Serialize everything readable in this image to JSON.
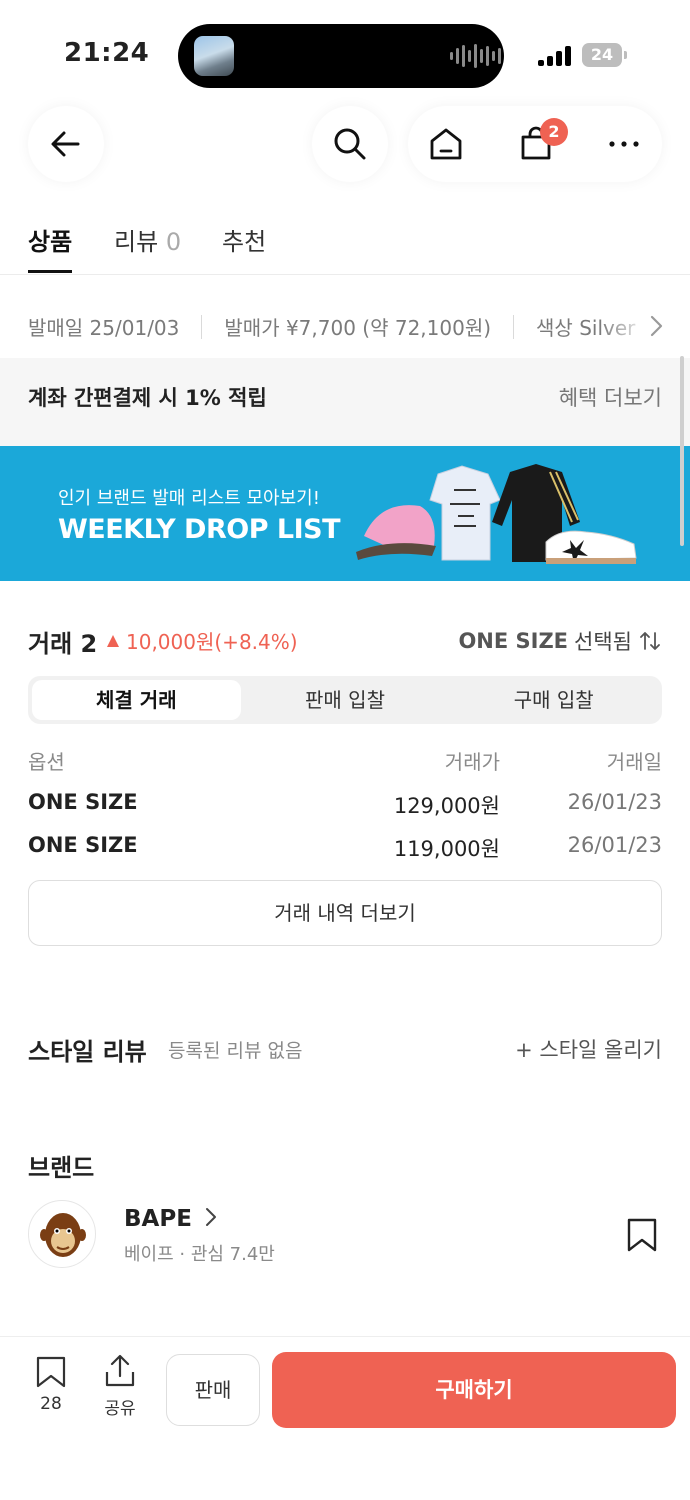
{
  "status_bar": {
    "time": "21:24",
    "battery": "24"
  },
  "header": {
    "cart_count": "2"
  },
  "tabs": [
    {
      "label": "상품"
    },
    {
      "label": "리뷰",
      "count": "0"
    },
    {
      "label": "추천"
    }
  ],
  "info_strip": {
    "release_date": "발매일 25/01/03",
    "release_price": "발매가 ¥7,700 (약 72,100원)",
    "color": "색상 Silver"
  },
  "benefit": {
    "text": "계좌 간편결제 시 1% 적립",
    "link": "혜택 더보기"
  },
  "banner": {
    "subtitle": "인기 브랜드 발매 리스트 모아보기!",
    "title": "WEEKLY DROP LIST"
  },
  "trades": {
    "title": "거래 2",
    "change": "10,000원(+8.4%)",
    "size_value": "ONE SIZE",
    "size_suffix": "선택됨",
    "segments": [
      "체결 거래",
      "판매 입찰",
      "구매 입찰"
    ],
    "headers": {
      "option": "옵션",
      "price": "거래가",
      "date": "거래일"
    },
    "rows": [
      {
        "option": "ONE SIZE",
        "price": "129,000원",
        "date": "26/01/23"
      },
      {
        "option": "ONE SIZE",
        "price": "119,000원",
        "date": "26/01/23"
      }
    ],
    "more": "거래 내역 더보기"
  },
  "style_review": {
    "title": "스타일 리뷰",
    "subtitle": "등록된 리뷰 없음",
    "add": "+ 스타일 올리기"
  },
  "brand": {
    "section": "브랜드",
    "name": "BAPE",
    "subtitle": "베이프 · 관심 7.4만"
  },
  "bottom_bar": {
    "bookmark_count": "28",
    "share": "공유",
    "sell": "판매",
    "buy": "구매하기"
  },
  "colors": {
    "accent": "#ef6253",
    "banner": "#1ba8d9"
  }
}
